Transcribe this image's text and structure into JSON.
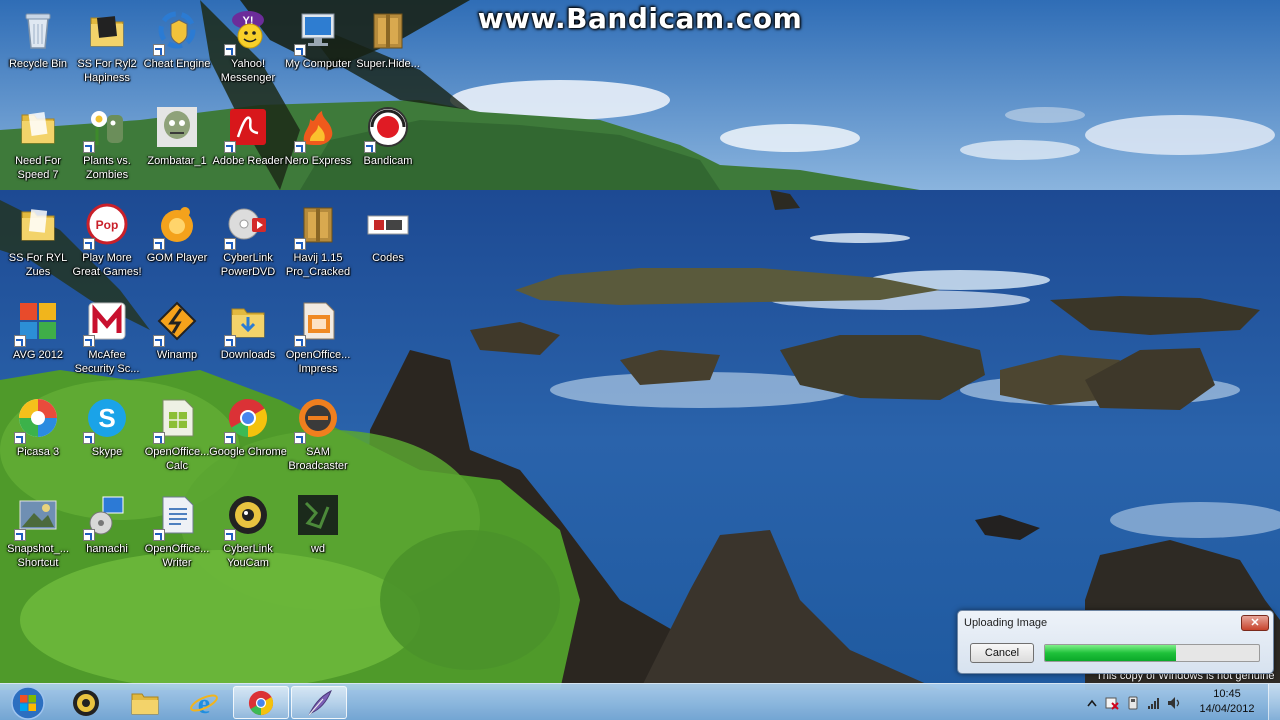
{
  "watermark": "www.Bandicam.com",
  "desktop_icons": [
    {
      "key": "recycle-bin",
      "label": "Recycle Bin",
      "shortcut": false,
      "icon": "recycle-bin-icon"
    },
    {
      "key": "ss-for-ryl2",
      "label": "SS For Ryl2 Hapiness",
      "shortcut": false,
      "icon": "folder-icon"
    },
    {
      "key": "cheat-engine",
      "label": "Cheat Engine",
      "shortcut": true,
      "icon": "cheat-engine-icon"
    },
    {
      "key": "yahoo-messenger",
      "label": "Yahoo! Messenger",
      "shortcut": true,
      "icon": "yahoo-messenger-icon"
    },
    {
      "key": "my-computer",
      "label": "My Computer",
      "shortcut": true,
      "icon": "computer-icon"
    },
    {
      "key": "super-hide",
      "label": "Super.Hide...",
      "shortcut": false,
      "icon": "archive-icon"
    },
    {
      "key": "need-for-speed",
      "label": "Need For Speed 7",
      "shortcut": false,
      "icon": "folder-icon"
    },
    {
      "key": "plants-vs-zombies",
      "label": "Plants vs. Zombies",
      "shortcut": true,
      "icon": "plants-vs-zombies-icon"
    },
    {
      "key": "zombatar",
      "label": "Zombatar_1",
      "shortcut": false,
      "icon": "zombie-icon"
    },
    {
      "key": "adobe-reader",
      "label": "Adobe Reader",
      "shortcut": true,
      "icon": "adobe-reader-icon"
    },
    {
      "key": "nero-express",
      "label": "Nero Express",
      "shortcut": true,
      "icon": "nero-icon"
    },
    {
      "key": "bandicam",
      "label": "Bandicam",
      "shortcut": true,
      "icon": "bandicam-icon"
    },
    {
      "key": "ss-for-ryl-zues",
      "label": "SS For RYL Zues",
      "shortcut": false,
      "icon": "folder-icon"
    },
    {
      "key": "play-more-great-games",
      "label": "Play More Great Games!",
      "shortcut": true,
      "icon": "popcap-icon"
    },
    {
      "key": "gom-player",
      "label": "GOM Player",
      "shortcut": true,
      "icon": "gom-player-icon"
    },
    {
      "key": "cyberlink-powerdvd",
      "label": "CyberLink PowerDVD",
      "shortcut": true,
      "icon": "powerdvd-icon"
    },
    {
      "key": "havij",
      "label": "Havij 1.15 Pro_Cracked",
      "shortcut": true,
      "icon": "archive-icon"
    },
    {
      "key": "codes",
      "label": "Codes",
      "shortcut": false,
      "icon": "text-file-icon"
    },
    {
      "key": "avg-2012",
      "label": "AVG 2012",
      "shortcut": true,
      "icon": "avg-icon"
    },
    {
      "key": "mcafee",
      "label": "McAfee Security Sc...",
      "shortcut": true,
      "icon": "mcafee-icon"
    },
    {
      "key": "winamp",
      "label": "Winamp",
      "shortcut": true,
      "icon": "winamp-icon"
    },
    {
      "key": "downloads",
      "label": "Downloads",
      "shortcut": true,
      "icon": "folder-icon"
    },
    {
      "key": "openoffice-impress",
      "label": "OpenOffice... Impress",
      "shortcut": true,
      "icon": "openoffice-impress-icon"
    },
    {
      "key": "picasa-3",
      "label": "Picasa 3",
      "shortcut": true,
      "icon": "picasa-icon"
    },
    {
      "key": "skype",
      "label": "Skype",
      "shortcut": true,
      "icon": "skype-icon"
    },
    {
      "key": "openoffice-calc",
      "label": "OpenOffice... Calc",
      "shortcut": true,
      "icon": "openoffice-calc-icon"
    },
    {
      "key": "google-chrome",
      "label": "Google Chrome",
      "shortcut": true,
      "icon": "chrome-icon"
    },
    {
      "key": "sam-broadcaster",
      "label": "SAM Broadcaster",
      "shortcut": true,
      "icon": "sam-broadcaster-icon"
    },
    {
      "key": "snapshot-shortcut",
      "label": "Snapshot_... Shortcut",
      "shortcut": true,
      "icon": "image-icon"
    },
    {
      "key": "hamachi",
      "label": "hamachi",
      "shortcut": true,
      "icon": "hamachi-icon"
    },
    {
      "key": "openoffice-writer",
      "label": "OpenOffice... Writer",
      "shortcut": true,
      "icon": "openoffice-writer-icon"
    },
    {
      "key": "cyberlink-youcam",
      "label": "CyberLink YouCam",
      "shortcut": true,
      "icon": "youcam-icon"
    },
    {
      "key": "wd",
      "label": "wd",
      "shortcut": false,
      "icon": "image-icon"
    }
  ],
  "upload_dialog": {
    "title": "Uploading Image",
    "close_glyph": "✕",
    "cancel_label": "Cancel",
    "progress_fraction": 0.61
  },
  "taskbar": {
    "pinned": [
      "start-button",
      "gom-player",
      "windows-explorer",
      "internet-explorer",
      "google-chrome",
      "feather-app"
    ],
    "clock_time": "10:45",
    "clock_date": "14/04/2012"
  },
  "genuine_notice": "This copy of Windows is not genuine",
  "colors": {
    "sky": "#3f7fc6",
    "sea": "#2158a4",
    "foliage": "#4f9a2a",
    "progress_green": "#1fc13a",
    "taskbar": "#9cc3e6"
  }
}
